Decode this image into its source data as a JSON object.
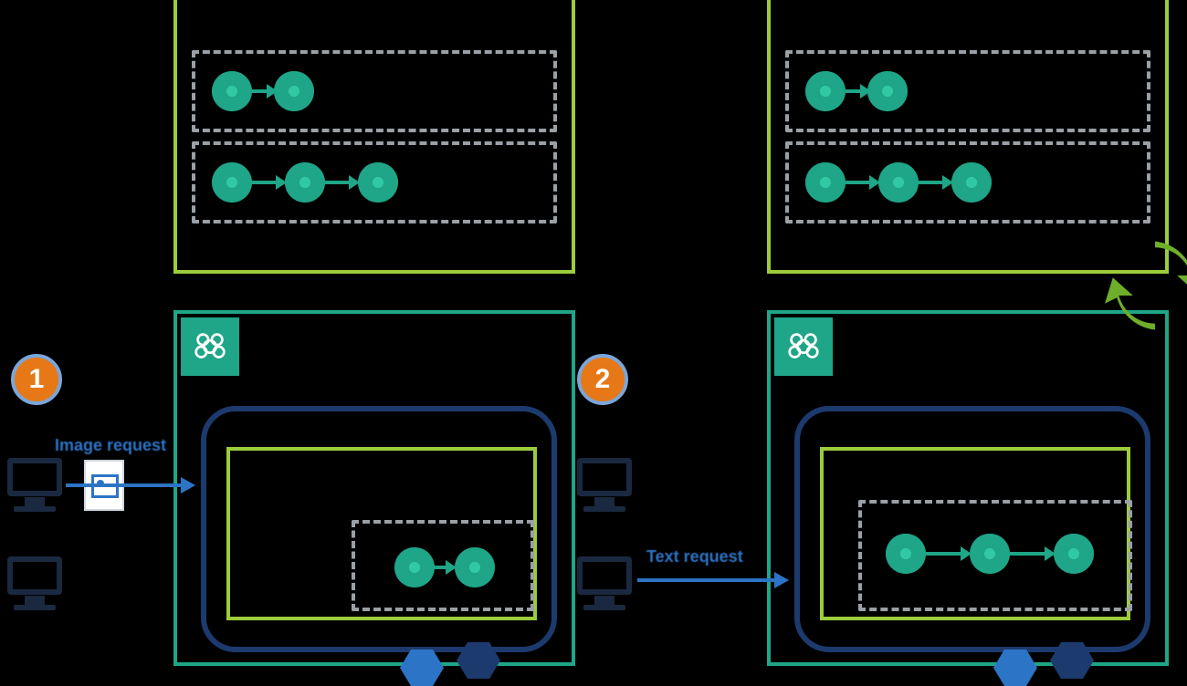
{
  "steps": {
    "one": "1",
    "two": "2"
  },
  "requests": {
    "image_label": "Image request",
    "text_label": "Text request"
  },
  "icons": {
    "brain": "brain-icon",
    "computer": "computer-icon",
    "document": "image-document-icon",
    "refresh": "refresh-arrows-icon",
    "hex": "hex-icon",
    "node": "model-node-icon"
  },
  "colors": {
    "green": "#9ccc3c",
    "teal": "#1fa587",
    "navy": "#1d3a6e",
    "blue": "#2c74c6",
    "orange": "#e67817",
    "dash": "#9aa0a6",
    "dark": "#1a2940"
  }
}
